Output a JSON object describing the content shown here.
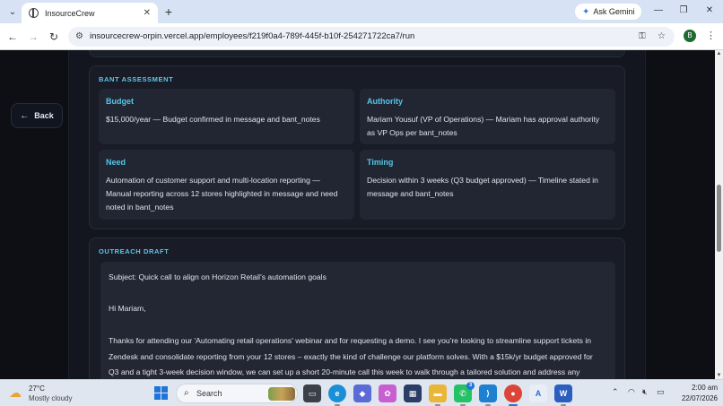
{
  "browser": {
    "tab_title": "InsourceCrew",
    "new_tab_symbol": "+",
    "gemini_label": "Ask Gemini",
    "url": "insourcecrew-orpin.vercel.app/employees/f219f0a4-789f-445f-b10f-254271722ca7/run",
    "profile_initial": "B"
  },
  "page": {
    "back_label": "Back",
    "bant": {
      "title": "BANT ASSESSMENT",
      "cards": [
        {
          "label": "Budget",
          "body": "$15,000/year — Budget confirmed in message and bant_notes"
        },
        {
          "label": "Authority",
          "body": "Mariam Yousuf (VP of Operations) — Mariam has approval authority as VP Ops per bant_notes"
        },
        {
          "label": "Need",
          "body": "Automation of customer support and multi-location reporting — Manual reporting across 12 stores highlighted in message and need noted in bant_notes"
        },
        {
          "label": "Timing",
          "body": "Decision within 3 weeks (Q3 budget approved) — Timeline stated in message and bant_notes"
        }
      ]
    },
    "outreach": {
      "title": "OUTREACH DRAFT",
      "lines": [
        "Subject: Quick call to align on Horizon Retail's automation goals",
        "Hi Mariam,",
        "Thanks for attending our 'Automating retail operations' webinar and for requesting a demo. I see you're looking to streamline support tickets in",
        "Zendesk and consolidate reporting from your 12 stores – exactly the kind of challenge our platform solves. With a $15k/yr budget approved for",
        "Q3 and a tight 3-week decision window, we can set up a short 20-minute call this week to walk through a tailored solution and address any"
      ]
    }
  },
  "taskbar": {
    "weather_temp": "27°C",
    "weather_condition": "Mostly cloudy",
    "search_label": "Search",
    "whatsapp_badge": "3",
    "time": "2:00 am",
    "date": "22/07/2026"
  },
  "colors": {
    "accent": "#5cc8ea",
    "card_bg": "#222633",
    "section_bg": "#191c26",
    "page_bg": "#0d0f14"
  }
}
